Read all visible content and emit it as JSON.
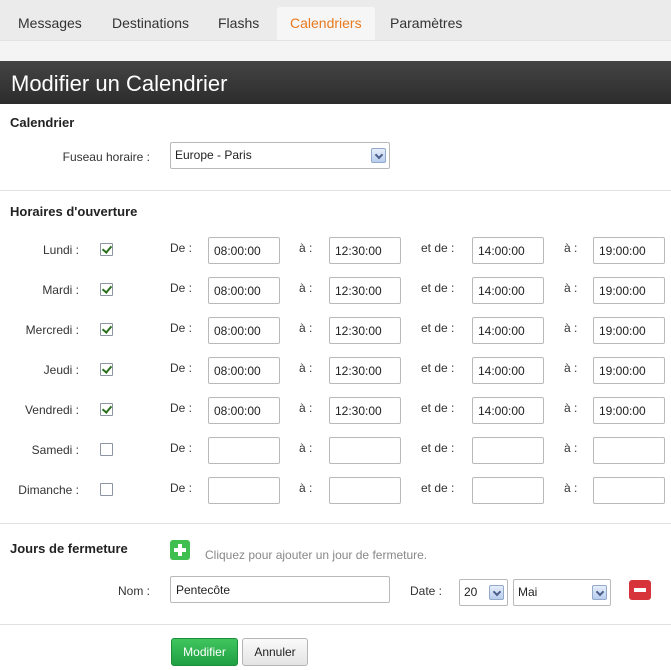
{
  "tabs": [
    {
      "label": "Messages",
      "active": false
    },
    {
      "label": "Destinations",
      "active": false
    },
    {
      "label": "Flashs",
      "active": false
    },
    {
      "label": "Calendriers",
      "active": true
    },
    {
      "label": "Paramètres",
      "active": false
    }
  ],
  "page_title": "Modifier un Calendrier",
  "calendar_section": {
    "title": "Calendrier",
    "timezone_label": "Fuseau horaire :",
    "timezone_value": "Europe - Paris"
  },
  "hours_section": {
    "title": "Horaires d'ouverture",
    "from_label": "De :",
    "to_label": "à :",
    "and_from_label": "et de :",
    "days": [
      {
        "label": "Lundi :",
        "checked": true,
        "from1": "08:00:00",
        "to1": "12:30:00",
        "from2": "14:00:00",
        "to2": "19:00:00"
      },
      {
        "label": "Mardi :",
        "checked": true,
        "from1": "08:00:00",
        "to1": "12:30:00",
        "from2": "14:00:00",
        "to2": "19:00:00"
      },
      {
        "label": "Mercredi :",
        "checked": true,
        "from1": "08:00:00",
        "to1": "12:30:00",
        "from2": "14:00:00",
        "to2": "19:00:00"
      },
      {
        "label": "Jeudi :",
        "checked": true,
        "from1": "08:00:00",
        "to1": "12:30:00",
        "from2": "14:00:00",
        "to2": "19:00:00"
      },
      {
        "label": "Vendredi :",
        "checked": true,
        "from1": "08:00:00",
        "to1": "12:30:00",
        "from2": "14:00:00",
        "to2": "19:00:00"
      },
      {
        "label": "Samedi :",
        "checked": false,
        "from1": "",
        "to1": "",
        "from2": "",
        "to2": ""
      },
      {
        "label": "Dimanche :",
        "checked": false,
        "from1": "",
        "to1": "",
        "from2": "",
        "to2": ""
      }
    ]
  },
  "closure_section": {
    "title": "Jours de fermeture",
    "add_hint": "Cliquez pour ajouter un jour de fermeture.",
    "name_label": "Nom :",
    "name_value": "Pentecôte",
    "date_label": "Date :",
    "day_value": "20",
    "month_value": "Mai"
  },
  "actions": {
    "save_label": "Modifier",
    "cancel_label": "Annuler"
  },
  "colors": {
    "active_tab": "#e8791e",
    "title_bar": "#353535",
    "add_button": "#3fbf4f",
    "remove_button": "#d6333b",
    "save_button": "#26b14b"
  }
}
